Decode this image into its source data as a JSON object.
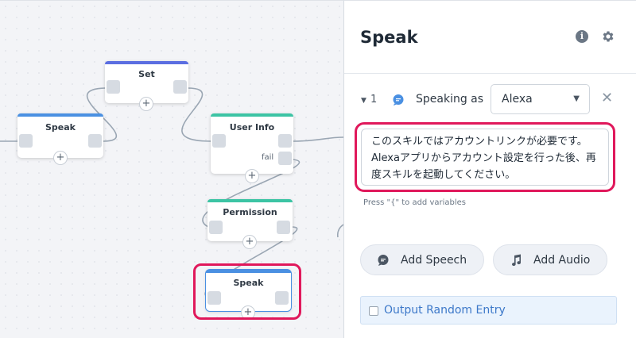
{
  "canvas": {
    "nodes": [
      {
        "title": "Set",
        "color": "#5b6ee1"
      },
      {
        "title": "Speak",
        "color": "#4a90e2"
      },
      {
        "title": "User Info",
        "color": "#3cc4a4",
        "port_label": "fail"
      },
      {
        "title": "Permission",
        "color": "#3cc4a4"
      },
      {
        "title": "Speak",
        "color": "#4a90e2"
      }
    ],
    "plus_glyph": "+"
  },
  "panel": {
    "title": "Speak",
    "step": {
      "number": "1",
      "speaking_as_label": "Speaking as",
      "voice": "Alexa"
    },
    "speech_text": "このスキルではアカウントリンクが必要です。Alexaアプリからアカウント設定を行った後、再度スキルを起動してください。",
    "hint": "Press \"{\" to add variables",
    "add_speech_label": "Add Speech",
    "add_audio_label": "Add Audio",
    "random_entry_label": "Output Random Entry"
  },
  "colors": {
    "highlight": "#e0185b",
    "accent_blue": "#3c78c9"
  },
  "icons": [
    "info-icon",
    "gear-icon",
    "caret-down-icon",
    "speech-bubble-icon",
    "chevron-down-icon",
    "close-icon",
    "music-note-icon",
    "checkbox-icon"
  ]
}
